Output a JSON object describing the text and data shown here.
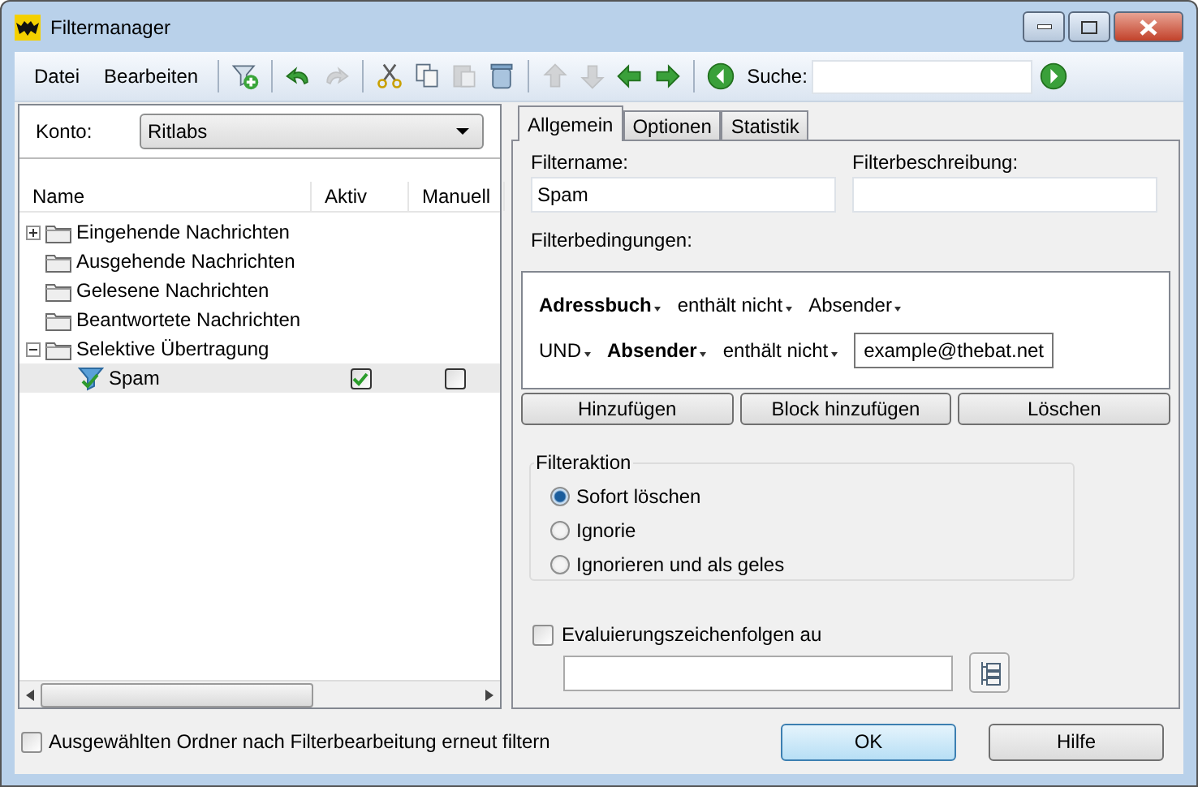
{
  "window": {
    "title": "Filtermanager"
  },
  "menu": [
    {
      "label": "Datei"
    },
    {
      "label": "Bearbeiten"
    }
  ],
  "toolbar": {
    "buttons": [
      {
        "kind": "filter-add",
        "disabled": false
      },
      {
        "kind": "sep"
      },
      {
        "kind": "undo",
        "disabled": false
      },
      {
        "kind": "redo",
        "disabled": true
      },
      {
        "kind": "sep"
      },
      {
        "kind": "cut",
        "disabled": false
      },
      {
        "kind": "copy",
        "disabled": false
      },
      {
        "kind": "paste",
        "disabled": true
      },
      {
        "kind": "delete",
        "disabled": false
      },
      {
        "kind": "sep"
      },
      {
        "kind": "up",
        "disabled": true
      },
      {
        "kind": "down",
        "disabled": true
      },
      {
        "kind": "left",
        "disabled": false
      },
      {
        "kind": "right",
        "disabled": false
      },
      {
        "kind": "sep"
      },
      {
        "kind": "back",
        "disabled": false
      }
    ],
    "search_label": "Suche:"
  },
  "account": {
    "label": "Konto:",
    "value": "Ritlabs"
  },
  "tree": {
    "columns": [
      "Name",
      "Aktiv",
      "Manuell"
    ],
    "items": [
      {
        "label": "Eingehende Nachrichten",
        "expanded": false
      },
      {
        "label": "Ausgehende Nachrichten"
      },
      {
        "label": "Gelesene Nachrichten"
      },
      {
        "label": "Beantwortete Nachrichten"
      },
      {
        "label": "Selektive Übertragung",
        "expanded": true,
        "children": [
          {
            "label": "Spam",
            "selected": true,
            "active": true,
            "manual": false
          }
        ]
      }
    ]
  },
  "tabs": [
    {
      "label": "Allgemein",
      "selected": true
    },
    {
      "label": "Optionen",
      "selected": false
    },
    {
      "label": "Statistik",
      "selected": false
    }
  ],
  "general": {
    "name_label": "Filtername:",
    "name_value": "Spam",
    "desc_label": "Filterbeschreibung:",
    "conditions_label": "Filterbedingungen:",
    "conditions": [
      {
        "parts": [
          {
            "text": "Adressbuch",
            "bold": true
          },
          {
            "text": "enthält nicht",
            "bold": false
          },
          {
            "text": "Absender",
            "bold": false
          }
        ]
      },
      {
        "parts": [
          {
            "text": "UND",
            "bold": false
          },
          {
            "text": "Absender",
            "bold": true
          },
          {
            "text": "enthält nicht",
            "bold": false
          }
        ],
        "value": "example@thebat.net"
      }
    ],
    "condition_buttons": [
      "Hinzufügen",
      "Block hinzufügen",
      "Löschen"
    ],
    "action_label": "Filteraktion",
    "actions": [
      {
        "label": "Sofort löschen",
        "selected": true
      },
      {
        "label": "Ignorie",
        "selected": false
      },
      {
        "label": "Ignorieren und als geles",
        "selected": false
      }
    ],
    "eval": {
      "label": "Evaluierungszeichenfolgen au",
      "checked": false
    }
  },
  "refilter": {
    "label": "Ausgewählten Ordner nach Filterbearbeitung erneut filtern",
    "checked": false
  },
  "buttons": [
    {
      "label": "OK",
      "default": true
    },
    {
      "label": "Hilfe",
      "default": false
    }
  ]
}
